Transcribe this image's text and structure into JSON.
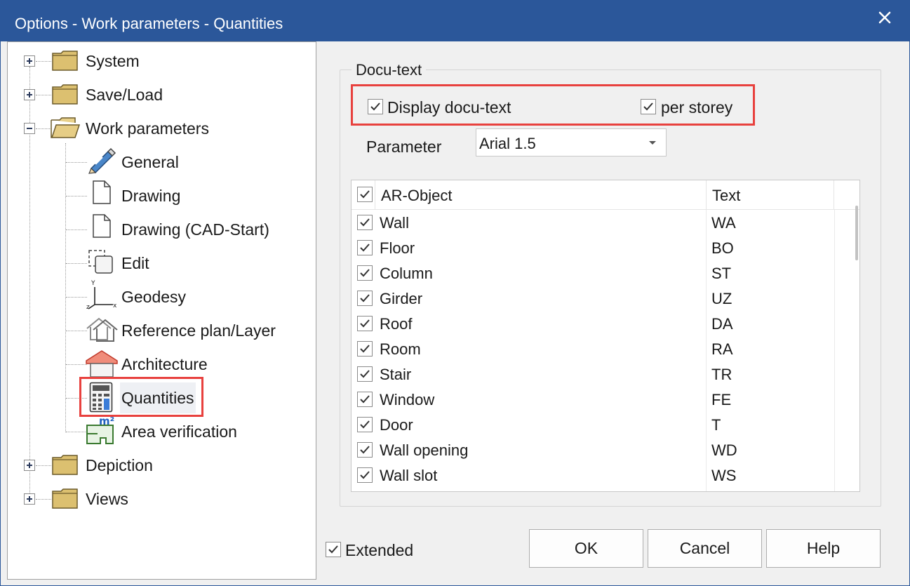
{
  "window": {
    "title": "Options - Work parameters - Quantities",
    "close_glyph": "✕"
  },
  "tree": {
    "items": [
      {
        "label": "System",
        "icon": "folder-icon",
        "expander": "plus"
      },
      {
        "label": "Save/Load",
        "icon": "folder-icon",
        "expander": "plus"
      },
      {
        "label": "Work parameters",
        "icon": "folder-open-icon",
        "expander": "minus"
      },
      {
        "label": "General",
        "icon": "pencil-icon"
      },
      {
        "label": "Drawing",
        "icon": "document-icon"
      },
      {
        "label": "Drawing (CAD-Start)",
        "icon": "document-icon"
      },
      {
        "label": "Edit",
        "icon": "edit-selection-icon"
      },
      {
        "label": "Geodesy",
        "icon": "axes-icon"
      },
      {
        "label": "Reference plan/Layer",
        "icon": "reference-house-icon"
      },
      {
        "label": "Architecture",
        "icon": "architecture-house-icon"
      },
      {
        "label": "Quantities",
        "icon": "calculator-icon",
        "selected": true
      },
      {
        "label": "Area verification",
        "icon": "area-m2-icon"
      },
      {
        "label": "Depiction",
        "icon": "folder-icon",
        "expander": "plus"
      },
      {
        "label": "Views",
        "icon": "folder-icon",
        "expander": "plus"
      }
    ]
  },
  "docu_text": {
    "group_title": "Docu-text",
    "display_label": "Display docu-text",
    "display_checked": true,
    "per_storey_label": "per storey",
    "per_storey_checked": true,
    "parameter_label": "Parameter",
    "parameter_value": "Arial 1.5"
  },
  "list": {
    "header_checked": true,
    "columns": [
      "AR-Object",
      "Text"
    ],
    "rows": [
      {
        "name": "Wall",
        "text": "WA",
        "checked": true
      },
      {
        "name": "Floor",
        "text": "BO",
        "checked": true
      },
      {
        "name": "Column",
        "text": "ST",
        "checked": true
      },
      {
        "name": "Girder",
        "text": "UZ",
        "checked": true
      },
      {
        "name": "Roof",
        "text": "DA",
        "checked": true
      },
      {
        "name": "Room",
        "text": "RA",
        "checked": true
      },
      {
        "name": "Stair",
        "text": "TR",
        "checked": true
      },
      {
        "name": "Window",
        "text": "FE",
        "checked": true
      },
      {
        "name": "Door",
        "text": "T",
        "checked": true
      },
      {
        "name": "Wall opening",
        "text": "WD",
        "checked": true
      },
      {
        "name": "Wall slot",
        "text": "WS",
        "checked": true
      }
    ]
  },
  "footer": {
    "extended_label": "Extended",
    "extended_checked": true,
    "ok_label": "OK",
    "cancel_label": "Cancel",
    "help_label": "Help"
  },
  "colors": {
    "title_bar": "#2b579a",
    "highlight": "#e8413e",
    "folder": "#dcc070"
  }
}
